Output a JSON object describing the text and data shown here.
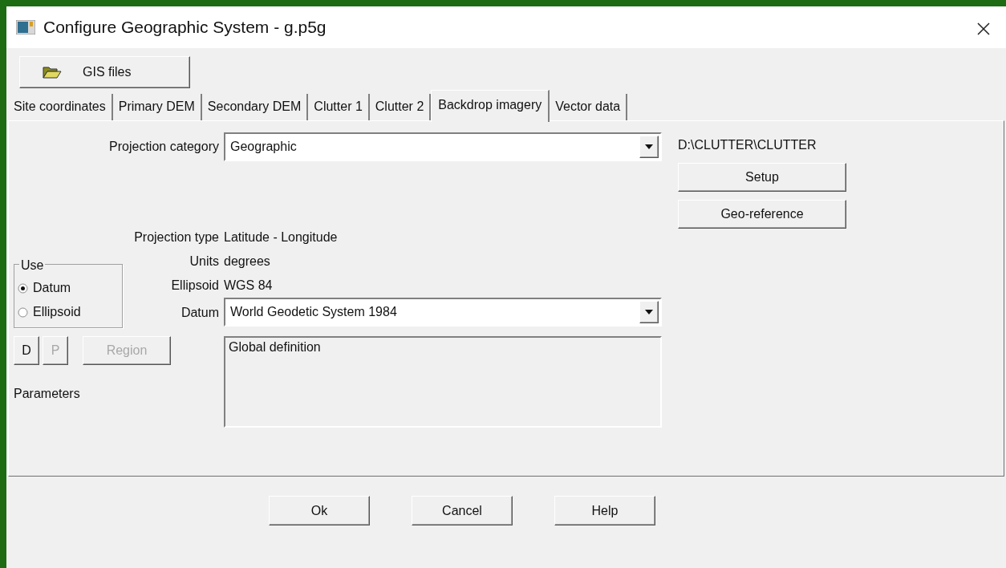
{
  "window": {
    "title": "Configure Geographic System - g.p5g"
  },
  "toolbar": {
    "gis_button": "GIS files"
  },
  "tabs": [
    {
      "label": "Site coordinates",
      "selected": false
    },
    {
      "label": "Primary DEM",
      "selected": false
    },
    {
      "label": "Secondary DEM",
      "selected": false
    },
    {
      "label": "Clutter 1",
      "selected": false
    },
    {
      "label": "Clutter 2",
      "selected": false
    },
    {
      "label": "Backdrop imagery",
      "selected": true
    },
    {
      "label": "Vector data",
      "selected": false
    }
  ],
  "projection_category": {
    "label": "Projection category",
    "value": "Geographic"
  },
  "info": [
    {
      "label": "Projection type",
      "value": "Latitude - Longitude"
    },
    {
      "label": "Units",
      "value": "degrees"
    },
    {
      "label": "Ellipsoid",
      "value": "WGS 84"
    }
  ],
  "use_group": {
    "title": "Use",
    "options": [
      {
        "label": "Datum",
        "selected": true
      },
      {
        "label": "Ellipsoid",
        "selected": false
      }
    ]
  },
  "datum": {
    "label": "Datum",
    "value": "World Geodetic System 1984"
  },
  "description": "Global definition",
  "parameter_buttons": [
    {
      "label": "D",
      "disabled": false
    },
    {
      "label": "P",
      "disabled": true
    },
    {
      "label": "Region",
      "disabled": true
    }
  ],
  "parameters_label": "Parameters",
  "path": "D:\\CLUTTER\\CLUTTER",
  "side_buttons": [
    "Setup",
    "Geo-reference"
  ],
  "dialog_buttons": [
    "Ok",
    "Cancel",
    "Help"
  ]
}
